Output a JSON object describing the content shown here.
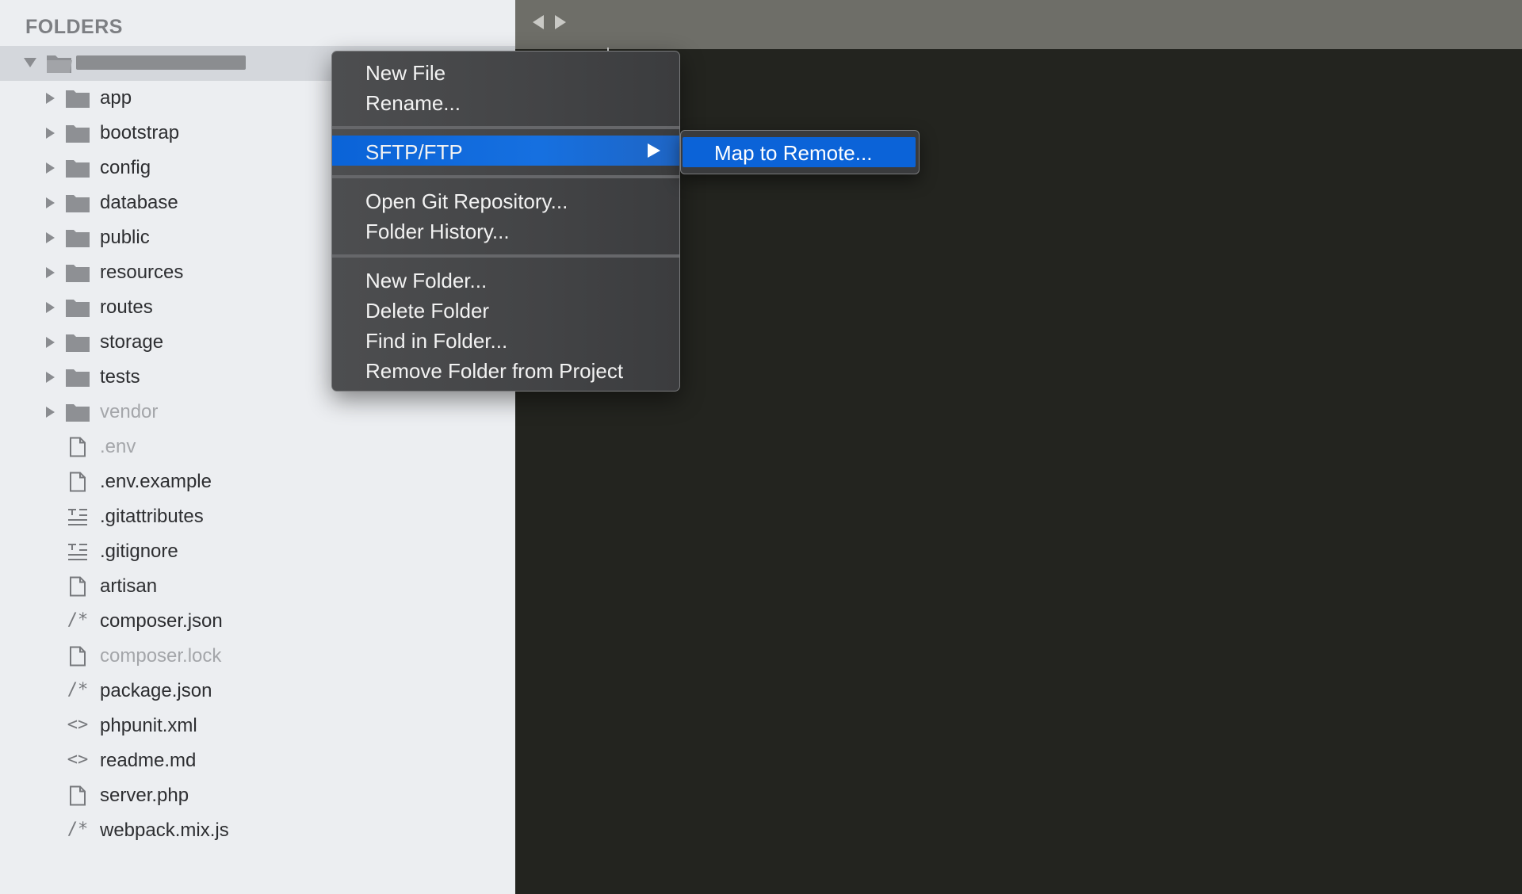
{
  "sidebar": {
    "header": "FOLDERS",
    "folders": [
      {
        "label": "app",
        "dim": false
      },
      {
        "label": "bootstrap",
        "dim": false
      },
      {
        "label": "config",
        "dim": false
      },
      {
        "label": "database",
        "dim": false
      },
      {
        "label": "public",
        "dim": false
      },
      {
        "label": "resources",
        "dim": false
      },
      {
        "label": "routes",
        "dim": false
      },
      {
        "label": "storage",
        "dim": false
      },
      {
        "label": "tests",
        "dim": false
      },
      {
        "label": "vendor",
        "dim": true
      }
    ],
    "files": [
      {
        "label": ".env",
        "icon": "file-icon",
        "dim": true
      },
      {
        "label": ".env.example",
        "icon": "file-icon",
        "dim": false
      },
      {
        "label": ".gitattributes",
        "icon": "text-lines-icon",
        "dim": false
      },
      {
        "label": ".gitignore",
        "icon": "text-lines-icon",
        "dim": false
      },
      {
        "label": "artisan",
        "icon": "file-icon",
        "dim": false
      },
      {
        "label": "composer.json",
        "icon": "comment-code-icon",
        "glyph": "/*",
        "dim": false
      },
      {
        "label": "composer.lock",
        "icon": "file-icon",
        "dim": true
      },
      {
        "label": "package.json",
        "icon": "comment-code-icon",
        "glyph": "/*",
        "dim": false
      },
      {
        "label": "phpunit.xml",
        "icon": "markup-code-icon",
        "glyph": "<>",
        "dim": false
      },
      {
        "label": "readme.md",
        "icon": "markup-code-icon",
        "glyph": "<>",
        "dim": false
      },
      {
        "label": "server.php",
        "icon": "file-icon",
        "dim": false
      },
      {
        "label": "webpack.mix.js",
        "icon": "comment-code-icon",
        "glyph": "/*",
        "dim": false
      }
    ]
  },
  "context_menu": {
    "items": {
      "new_file": "New File",
      "rename": "Rename...",
      "sftp": "SFTP/FTP",
      "open_git": "Open Git Repository...",
      "folder_history": "Folder History...",
      "new_folder": "New Folder...",
      "delete_folder": "Delete Folder",
      "find_in_folder": "Find in Folder...",
      "remove_folder": "Remove Folder from Project"
    },
    "submenu": {
      "map_to_remote": "Map to Remote..."
    }
  },
  "colors": {
    "sidebar_bg": "#eceef1",
    "editor_bg": "#23241f",
    "tabbar_bg": "#6e6e68",
    "highlight": "#0b63d8"
  }
}
